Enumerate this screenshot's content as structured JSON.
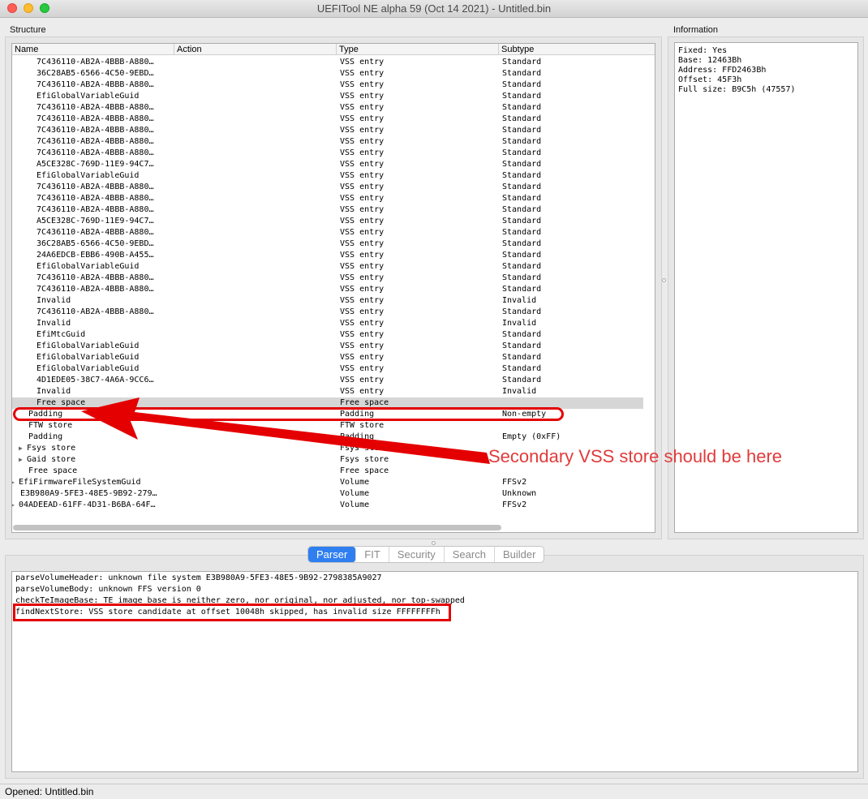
{
  "window": {
    "title": "UEFITool NE alpha 59 (Oct 14 2021) - Untitled.bin"
  },
  "structure": {
    "label": "Structure",
    "columns": [
      "Name",
      "Action",
      "Type",
      "Subtype"
    ],
    "rows": [
      {
        "name": "7C436110-AB2A-4BBB-A880…",
        "action": "",
        "type": "VSS entry",
        "subtype": "Standard",
        "indent": 2,
        "expander": false
      },
      {
        "name": "36C28AB5-6566-4C50-9EBD…",
        "action": "",
        "type": "VSS entry",
        "subtype": "Standard",
        "indent": 2,
        "expander": false
      },
      {
        "name": "7C436110-AB2A-4BBB-A880…",
        "action": "",
        "type": "VSS entry",
        "subtype": "Standard",
        "indent": 2,
        "expander": false
      },
      {
        "name": "EfiGlobalVariableGuid",
        "action": "",
        "type": "VSS entry",
        "subtype": "Standard",
        "indent": 2,
        "expander": false
      },
      {
        "name": "7C436110-AB2A-4BBB-A880…",
        "action": "",
        "type": "VSS entry",
        "subtype": "Standard",
        "indent": 2,
        "expander": false
      },
      {
        "name": "7C436110-AB2A-4BBB-A880…",
        "action": "",
        "type": "VSS entry",
        "subtype": "Standard",
        "indent": 2,
        "expander": false
      },
      {
        "name": "7C436110-AB2A-4BBB-A880…",
        "action": "",
        "type": "VSS entry",
        "subtype": "Standard",
        "indent": 2,
        "expander": false
      },
      {
        "name": "7C436110-AB2A-4BBB-A880…",
        "action": "",
        "type": "VSS entry",
        "subtype": "Standard",
        "indent": 2,
        "expander": false
      },
      {
        "name": "7C436110-AB2A-4BBB-A880…",
        "action": "",
        "type": "VSS entry",
        "subtype": "Standard",
        "indent": 2,
        "expander": false
      },
      {
        "name": "A5CE328C-769D-11E9-94C7…",
        "action": "",
        "type": "VSS entry",
        "subtype": "Standard",
        "indent": 2,
        "expander": false
      },
      {
        "name": "EfiGlobalVariableGuid",
        "action": "",
        "type": "VSS entry",
        "subtype": "Standard",
        "indent": 2,
        "expander": false
      },
      {
        "name": "7C436110-AB2A-4BBB-A880…",
        "action": "",
        "type": "VSS entry",
        "subtype": "Standard",
        "indent": 2,
        "expander": false
      },
      {
        "name": "7C436110-AB2A-4BBB-A880…",
        "action": "",
        "type": "VSS entry",
        "subtype": "Standard",
        "indent": 2,
        "expander": false
      },
      {
        "name": "7C436110-AB2A-4BBB-A880…",
        "action": "",
        "type": "VSS entry",
        "subtype": "Standard",
        "indent": 2,
        "expander": false
      },
      {
        "name": "A5CE328C-769D-11E9-94C7…",
        "action": "",
        "type": "VSS entry",
        "subtype": "Standard",
        "indent": 2,
        "expander": false
      },
      {
        "name": "7C436110-AB2A-4BBB-A880…",
        "action": "",
        "type": "VSS entry",
        "subtype": "Standard",
        "indent": 2,
        "expander": false
      },
      {
        "name": "36C28AB5-6566-4C50-9EBD…",
        "action": "",
        "type": "VSS entry",
        "subtype": "Standard",
        "indent": 2,
        "expander": false
      },
      {
        "name": "24A6EDCB-EBB6-490B-A455…",
        "action": "",
        "type": "VSS entry",
        "subtype": "Standard",
        "indent": 2,
        "expander": false
      },
      {
        "name": "EfiGlobalVariableGuid",
        "action": "",
        "type": "VSS entry",
        "subtype": "Standard",
        "indent": 2,
        "expander": false
      },
      {
        "name": "7C436110-AB2A-4BBB-A880…",
        "action": "",
        "type": "VSS entry",
        "subtype": "Standard",
        "indent": 2,
        "expander": false
      },
      {
        "name": "7C436110-AB2A-4BBB-A880…",
        "action": "",
        "type": "VSS entry",
        "subtype": "Standard",
        "indent": 2,
        "expander": false
      },
      {
        "name": "Invalid",
        "action": "",
        "type": "VSS entry",
        "subtype": "Invalid",
        "indent": 2,
        "expander": false
      },
      {
        "name": "7C436110-AB2A-4BBB-A880…",
        "action": "",
        "type": "VSS entry",
        "subtype": "Standard",
        "indent": 2,
        "expander": false
      },
      {
        "name": "Invalid",
        "action": "",
        "type": "VSS entry",
        "subtype": "Invalid",
        "indent": 2,
        "expander": false
      },
      {
        "name": "EfiMtcGuid",
        "action": "",
        "type": "VSS entry",
        "subtype": "Standard",
        "indent": 2,
        "expander": false
      },
      {
        "name": "EfiGlobalVariableGuid",
        "action": "",
        "type": "VSS entry",
        "subtype": "Standard",
        "indent": 2,
        "expander": false
      },
      {
        "name": "EfiGlobalVariableGuid",
        "action": "",
        "type": "VSS entry",
        "subtype": "Standard",
        "indent": 2,
        "expander": false
      },
      {
        "name": "EfiGlobalVariableGuid",
        "action": "",
        "type": "VSS entry",
        "subtype": "Standard",
        "indent": 2,
        "expander": false
      },
      {
        "name": "4D1EDE05-38C7-4A6A-9CC6…",
        "action": "",
        "type": "VSS entry",
        "subtype": "Standard",
        "indent": 2,
        "expander": false
      },
      {
        "name": "Invalid",
        "action": "",
        "type": "VSS entry",
        "subtype": "Invalid",
        "indent": 2,
        "expander": false
      },
      {
        "name": "Free space",
        "action": "",
        "type": "Free space",
        "subtype": "",
        "indent": 2,
        "expander": false,
        "selected": true
      },
      {
        "name": "Padding",
        "action": "",
        "type": "Padding",
        "subtype": "Non-empty",
        "indent": 1,
        "expander": false
      },
      {
        "name": "FTW store",
        "action": "",
        "type": "FTW store",
        "subtype": "",
        "indent": 1,
        "expander": false
      },
      {
        "name": "Padding",
        "action": "",
        "type": "Padding",
        "subtype": "Empty (0xFF)",
        "indent": 1,
        "expander": false
      },
      {
        "name": "Fsys store",
        "action": "",
        "type": "Fsys store",
        "subtype": "",
        "indent": 1,
        "expander": true
      },
      {
        "name": "Gaid store",
        "action": "",
        "type": "Fsys store",
        "subtype": "",
        "indent": 1,
        "expander": true
      },
      {
        "name": "Free space",
        "action": "",
        "type": "Free space",
        "subtype": "",
        "indent": 1,
        "expander": false
      },
      {
        "name": "EfiFirmwareFileSystemGuid",
        "action": "",
        "type": "Volume",
        "subtype": "FFSv2",
        "indent": 0,
        "expander": true
      },
      {
        "name": "E3B980A9-5FE3-48E5-9B92-279…",
        "action": "",
        "type": "Volume",
        "subtype": "Unknown",
        "indent": 0,
        "expander": false
      },
      {
        "name": "04ADEEAD-61FF-4D31-B6BA-64F…",
        "action": "",
        "type": "Volume",
        "subtype": "FFSv2",
        "indent": 0,
        "expander": true
      }
    ]
  },
  "information": {
    "label": "Information",
    "text": "Fixed: Yes\nBase: 12463Bh\nAddress: FFD2463Bh\nOffset: 45F3h\nFull size: B9C5h (47557)"
  },
  "tabs": [
    "Parser",
    "FIT",
    "Security",
    "Search",
    "Builder"
  ],
  "active_tab": "Parser",
  "log": [
    "parseVolumeHeader: unknown file system E3B980A9-5FE3-48E5-9B92-2798385A9027",
    "parseVolumeBody: unknown FFS version 0",
    "checkTeImageBase: TE image base is neither zero, nor original, nor adjusted, nor top-swapped",
    "findNextStore: VSS store candidate at offset 10048h skipped, has invalid size FFFFFFFFh"
  ],
  "status": "Opened: Untitled.bin",
  "annotation": {
    "text": "Secondary VSS store should be here",
    "color": "#e40000"
  },
  "colors": {
    "accent": "#2f7ff0",
    "selection": "#d6d6d6",
    "annotation": "#e40000"
  },
  "icons": {
    "expander": "triangle-right-icon"
  }
}
